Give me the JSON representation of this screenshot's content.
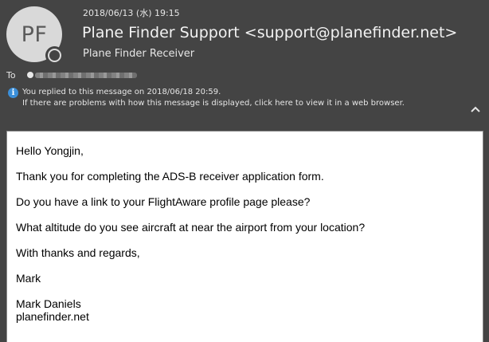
{
  "header": {
    "date": "2018/06/13 (水) 19:15",
    "avatar_initials": "PF",
    "sender": "Plane Finder Support <support@planefinder.net>",
    "subject": "Plane Finder Receiver",
    "to_label": "To",
    "info_replied": "You replied to this message on 2018/06/18 20:59.",
    "info_display": "If there are problems with how this message is displayed, click here to view it in a web browser.",
    "icons": {
      "info": "info-icon",
      "collapse": "chevron-up-icon",
      "presence": "presence-status-icon"
    },
    "info_icon_glyph": "i"
  },
  "message": {
    "greeting": "Hello Yongjin,",
    "paragraph1": "Thank you for completing the ADS-B receiver application form.",
    "paragraph2": "Do you have a link to your FlightAware profile page please?",
    "paragraph3": "What altitude do you see aircraft at near the airport from your location?",
    "closing": "With thanks and regards,",
    "signoff": "Mark",
    "signature_name": "Mark Daniels",
    "signature_site": "planefinder.net"
  },
  "colors": {
    "header_bg": "#444444",
    "header_text": "#e6e6e6",
    "info_blue": "#3b8fd9",
    "body_bg": "#ffffff"
  }
}
